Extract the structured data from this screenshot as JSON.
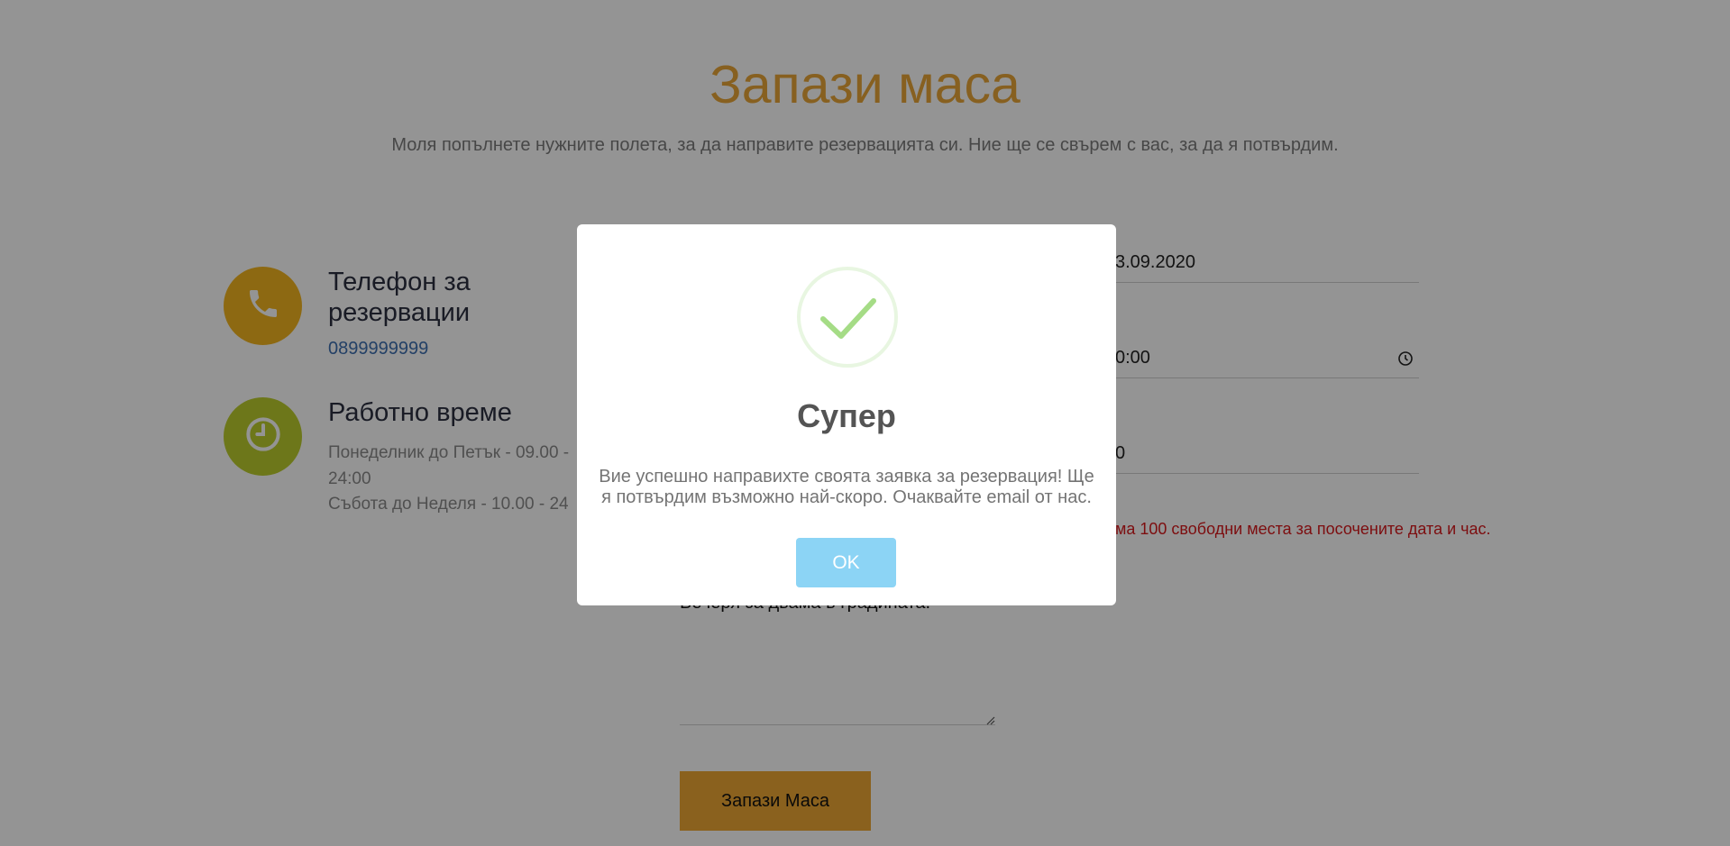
{
  "page": {
    "title": "Запази маса",
    "subtitle": "Моля попълнете нужните полета, за да направите резервацията си. Ние ще се свърем с вас, за да я потвърдим."
  },
  "contact": {
    "phone_title": "Телефон за резервации",
    "phone_number": "0899999999",
    "phone_icon": "phone-icon",
    "hours_title": "Работно време",
    "hours_icon": "clock-icon",
    "hours_weekdays": "Понеделник до Петък - 09.00 - 24:00",
    "hours_weekend": "Събота до Неделя - 10.00 - 24"
  },
  "form": {
    "date_value": "3.09.2020",
    "time_value": "0:00",
    "people_value": "0",
    "error_message": "ма 100 свободни места за посочените дата и час.",
    "note_value": "Вечеря за двама в градината.",
    "submit_label": "Запази Маса"
  },
  "modal": {
    "icon": "success-check-icon",
    "title": "Супер",
    "message": "Вие успешно направихте своята заявка за резервация! Ще я потвърдим възможно най-скоро. Очаквайте email от нас.",
    "ok_label": "OK"
  },
  "colors": {
    "accent": "#e8a637",
    "phone_circle": "#f3b61f",
    "clock_circle": "#bccd2e",
    "error": "#d8191c",
    "ok_button": "#8cd4f5",
    "success_check": "#a5dc86"
  }
}
